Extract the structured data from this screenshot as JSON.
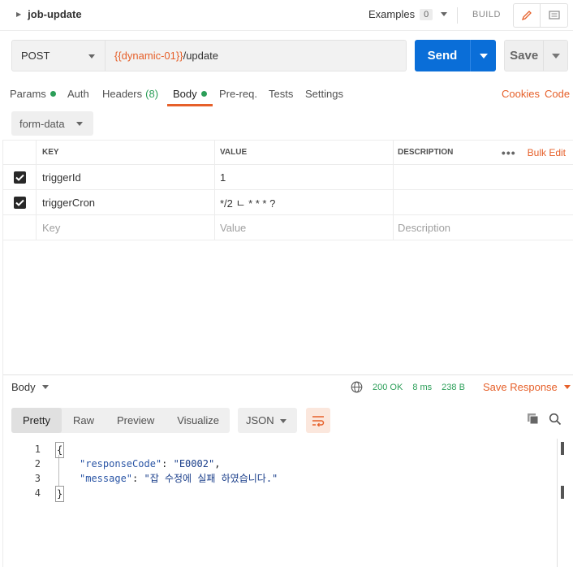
{
  "request": {
    "name": "job-update",
    "examples_label": "Examples",
    "examples_count": "0",
    "build_label": "BUILD",
    "method": "POST",
    "url_variable": "{{dynamic-01}}",
    "url_path": "/update",
    "send_label": "Send",
    "save_label": "Save"
  },
  "tabs": [
    {
      "label": "Params",
      "dot": true
    },
    {
      "label": "Auth"
    },
    {
      "label": "Headers",
      "count": "(8)"
    },
    {
      "label": "Body",
      "dot": true,
      "active": true
    },
    {
      "label": "Pre-req."
    },
    {
      "label": "Tests"
    },
    {
      "label": "Settings"
    }
  ],
  "tab_links": {
    "cookies": "Cookies",
    "code": "Code"
  },
  "body_mode": "form-data",
  "table": {
    "headers": {
      "key": "KEY",
      "value": "VALUE",
      "description": "DESCRIPTION"
    },
    "more_label": "•••",
    "bulk_edit": "Bulk Edit",
    "rows": [
      {
        "checked": true,
        "key": "triggerId",
        "value": "1",
        "description": ""
      },
      {
        "checked": true,
        "key": "triggerCron",
        "value": "*/2 ㄴ * * * ?",
        "description": ""
      }
    ],
    "placeholders": {
      "key": "Key",
      "value": "Value",
      "description": "Description"
    }
  },
  "response": {
    "body_label": "Body",
    "status": "200 OK",
    "time": "8 ms",
    "size": "238 B",
    "save_response": "Save Response",
    "view_tabs": [
      "Pretty",
      "Raw",
      "Preview",
      "Visualize"
    ],
    "active_view": "Pretty",
    "format": "JSON",
    "code_lines": [
      {
        "n": "1",
        "text": "{"
      },
      {
        "n": "2",
        "key": "\"responseCode\"",
        "value": "\"E0002\"",
        "trail": ","
      },
      {
        "n": "3",
        "key": "\"message\"",
        "value": "\"잡 수정에 실패 하였습니다.\"",
        "trail": ""
      },
      {
        "n": "4",
        "text": "}"
      }
    ]
  },
  "colors": {
    "accent": "#e6602a",
    "send": "#0a6ed8",
    "success": "#2b9e58"
  }
}
